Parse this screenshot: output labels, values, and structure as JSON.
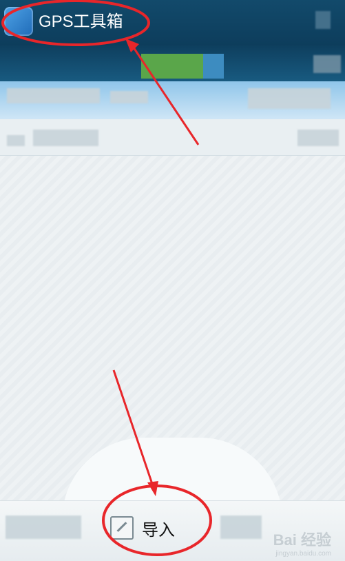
{
  "app": {
    "title": "GPS工具箱",
    "icon": "app-logo-icon"
  },
  "toolbar": {
    "import_label": "导入",
    "import_icon": "edit-icon"
  },
  "watermark": {
    "brand": "Bai 经验",
    "url": "jingyan.baidu.com"
  },
  "colors": {
    "title_bar": "#124a6b",
    "annotation": "#e8262a",
    "status_green": "#6bbf3a"
  }
}
